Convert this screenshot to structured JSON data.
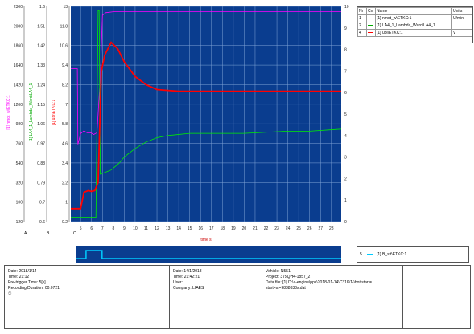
{
  "chart_data": {
    "type": "line",
    "x": {
      "label": "time s",
      "range": [
        4.1,
        28.9
      ],
      "ticks": [
        "5",
        "6",
        "7",
        "8",
        "9",
        "10",
        "11",
        "12",
        "13",
        "14",
        "15",
        "16",
        "17",
        "18",
        "19",
        "20",
        "21",
        "22",
        "23",
        "24",
        "25",
        "26",
        "27",
        "28"
      ]
    },
    "y_axes": [
      {
        "label": "[1] nmot_w\\ETKC:1",
        "color": "#ff00ff",
        "ticks": [
          "2300",
          "2080",
          "1860",
          "1640",
          "1420",
          "1200",
          "980",
          "760",
          "540",
          "320",
          "100",
          "-120"
        ],
        "range": [
          -120,
          2300
        ]
      },
      {
        "label": "[1] LA4_1_Lambda_Ward\\LA4_1",
        "color": "#00aa00",
        "ticks": [
          "1.6",
          "1.51",
          "1.42",
          "1.33",
          "1.24",
          "1.15",
          "1.06",
          "0.97",
          "0.88",
          "0.79",
          "0.7",
          "0.6"
        ],
        "range": [
          0.6,
          1.6
        ]
      },
      {
        "label": "[1] ubl\\ETKC:1",
        "color": "#ff0000",
        "ticks": [
          "13",
          "11.8",
          "10.6",
          "9.4",
          "8.2",
          "7",
          "5.8",
          "4.6",
          "3.4",
          "2.2",
          "1",
          "-0.2"
        ],
        "range": [
          -0.2,
          13
        ]
      }
    ],
    "right_axis": {
      "ticks": [
        "10",
        "9",
        "8",
        "7",
        "6",
        "5",
        "4",
        "3",
        "2",
        "1",
        "0"
      ]
    },
    "series": [
      {
        "name": "[1] nmot_w\\ETKC:1",
        "unit": "U/min",
        "color": "#ff00ff",
        "points": [
          [
            4.1,
            1600
          ],
          [
            4.7,
            1600
          ],
          [
            4.75,
            750
          ],
          [
            5.0,
            870
          ],
          [
            5.3,
            900
          ],
          [
            5.6,
            880
          ],
          [
            5.9,
            880
          ],
          [
            6.2,
            860
          ],
          [
            6.5,
            880
          ],
          [
            6.8,
            1500
          ],
          [
            7.0,
            2200
          ],
          [
            7.3,
            2230
          ],
          [
            8,
            2240
          ],
          [
            10,
            2240
          ],
          [
            12,
            2240
          ],
          [
            14,
            2240
          ],
          [
            16,
            2240
          ],
          [
            18,
            2240
          ],
          [
            20,
            2240
          ],
          [
            22,
            2240
          ],
          [
            24,
            2240
          ],
          [
            26,
            2240
          ],
          [
            28,
            2240
          ],
          [
            28.9,
            2240
          ]
        ]
      },
      {
        "name": "[1] LA4_1_Lambda_Ward\\LA4_1",
        "unit": "",
        "color": "#00ee00",
        "points": [
          [
            4.1,
            0.62
          ],
          [
            6.4,
            0.62
          ],
          [
            6.6,
            1.58
          ],
          [
            6.7,
            1.58
          ],
          [
            6.8,
            0.82
          ],
          [
            7.3,
            0.83
          ],
          [
            7.8,
            0.84
          ],
          [
            8.5,
            0.87
          ],
          [
            9,
            0.9
          ],
          [
            10,
            0.94
          ],
          [
            11,
            0.97
          ],
          [
            12,
            0.99
          ],
          [
            13,
            1.0
          ],
          [
            15,
            1.01
          ],
          [
            17,
            1.01
          ],
          [
            20,
            1.01
          ],
          [
            24,
            1.02
          ],
          [
            26,
            1.02
          ],
          [
            28.9,
            1.03
          ]
        ]
      },
      {
        "name": "[1] ubl\\ETKC:1",
        "unit": "V",
        "color": "#ff0000",
        "points": [
          [
            4.1,
            0.6
          ],
          [
            5.0,
            0.6
          ],
          [
            5.3,
            1.6
          ],
          [
            5.7,
            1.7
          ],
          [
            6.0,
            1.65
          ],
          [
            6.3,
            1.7
          ],
          [
            6.6,
            2.2
          ],
          [
            6.9,
            9.0
          ],
          [
            7.2,
            10.0
          ],
          [
            7.8,
            10.8
          ],
          [
            8.4,
            10.4
          ],
          [
            9,
            9.6
          ],
          [
            10,
            8.7
          ],
          [
            11,
            8.2
          ],
          [
            12,
            7.9
          ],
          [
            13,
            7.85
          ],
          [
            14,
            7.8
          ],
          [
            16,
            7.8
          ],
          [
            18,
            7.8
          ],
          [
            20,
            7.8
          ],
          [
            22,
            7.8
          ],
          [
            24,
            7.8
          ],
          [
            26,
            7.8
          ],
          [
            28.9,
            7.8
          ]
        ]
      }
    ],
    "digital_series": {
      "name": "[1] B_stt\\ETKC:1",
      "color": "#00ccff",
      "segments": [
        [
          4.1,
          0
        ],
        [
          5.0,
          0
        ],
        [
          5.0,
          1
        ],
        [
          6.5,
          1
        ],
        [
          6.5,
          0
        ],
        [
          28.9,
          0
        ]
      ]
    }
  },
  "legend": {
    "headers": [
      "Nr",
      "Cn",
      "Name",
      "Units"
    ],
    "rows": [
      {
        "nr": "1",
        "name": "[1] nmot_w\\ETKC:1",
        "unit": "U/min",
        "color": "#ff00ff"
      },
      {
        "nr": "2",
        "name": "[1] LA4_1_Lambda_Ward\\LA4_1",
        "unit": "",
        "color": "#00aa00"
      },
      {
        "nr": "4",
        "name": "[1] ubl\\ETKC:1",
        "unit": "V",
        "color": "#ff0000"
      }
    ]
  },
  "mini_legend": {
    "nr": "5",
    "name": "[1] B_stt\\ETKC:1",
    "color": "#00ccff"
  },
  "axis_letters": {
    "a": "A",
    "b": "B",
    "c": "C"
  },
  "info": {
    "col1": [
      "Date: 2018/1/14",
      "Time: 21:12",
      "Pre-trigger Time: 5[s]",
      "Recording Duration: 00:0721",
      "①"
    ],
    "col2": [
      "Date: 14/1/2018",
      "Time: 21:42:21",
      "User:",
      "Company: LIAES"
    ],
    "col3": [
      "Vehicle: N551",
      "Project: 375QH4-1857_2",
      "Data file: [1] D:\\a-engine\\pps\\2018-01-14\\C318\\T-\\hot start=",
      "start=st=9838633x.dat"
    ]
  }
}
